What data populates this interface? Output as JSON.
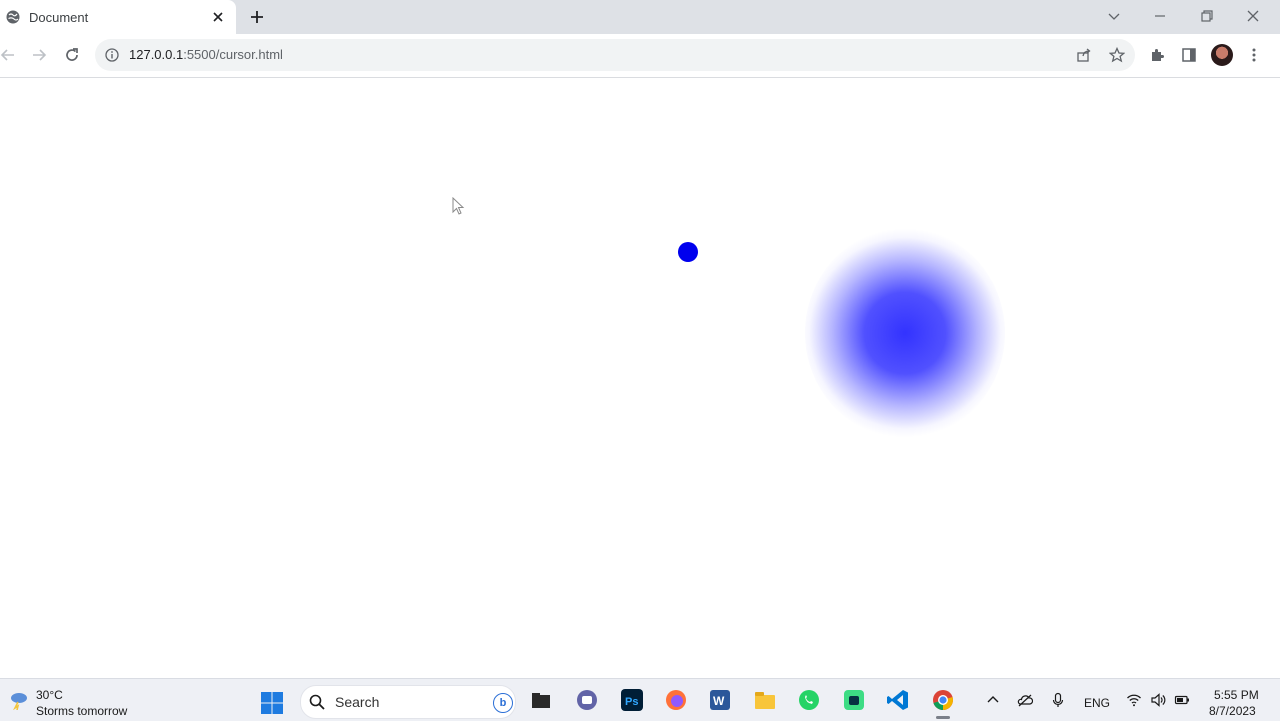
{
  "browser": {
    "tab_title": "Document",
    "url_host": "127.0.0.1",
    "url_path": ":5500/cursor.html",
    "icons": [
      "globe-icon",
      "close-icon",
      "plus-icon",
      "minimize-icon",
      "restore-icon",
      "window-close-icon",
      "chevron-down-icon",
      "back-arrow-icon",
      "forward-arrow-icon",
      "reload-icon",
      "info-icon",
      "share-icon",
      "star-icon",
      "extension-icon",
      "sidepanel-icon",
      "menu-icon"
    ]
  },
  "page": {
    "cursor_dot_color": "#0000ee",
    "cursor_glow_color": "#2828ff",
    "background": "#ffffff"
  },
  "taskbar": {
    "weather_temp": "30°C",
    "weather_desc": "Storms tomorrow",
    "search_label": "Search",
    "bing_label": "b",
    "apps": [
      "file-explorer",
      "teams-chat",
      "photoshop",
      "firefox",
      "word",
      "folder",
      "whatsapp",
      "android-studio",
      "vscode",
      "chrome"
    ],
    "language": "ENG",
    "time": "5:55 PM",
    "date": "8/7/2023"
  }
}
